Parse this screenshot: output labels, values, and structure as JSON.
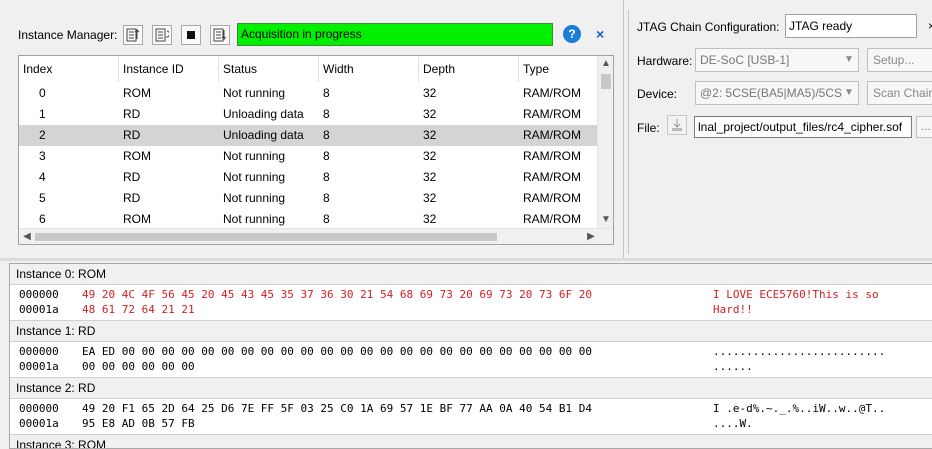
{
  "instance_manager": {
    "label": "Instance Manager:",
    "status_text": "Acquisition in progress",
    "help_label": "?",
    "close_label": "×",
    "columns": [
      "Index",
      "Instance ID",
      "Status",
      "Width",
      "Depth",
      "Type"
    ],
    "rows": [
      {
        "index": "0",
        "id": "ROM",
        "status": "Not running",
        "width": "8",
        "depth": "32",
        "type": "RAM/ROM"
      },
      {
        "index": "1",
        "id": "RD",
        "status": "Unloading data",
        "width": "8",
        "depth": "32",
        "type": "RAM/ROM"
      },
      {
        "index": "2",
        "id": "RD",
        "status": "Unloading data",
        "width": "8",
        "depth": "32",
        "type": "RAM/ROM"
      },
      {
        "index": "3",
        "id": "ROM",
        "status": "Not running",
        "width": "8",
        "depth": "32",
        "type": "RAM/ROM"
      },
      {
        "index": "4",
        "id": "RD",
        "status": "Not running",
        "width": "8",
        "depth": "32",
        "type": "RAM/ROM"
      },
      {
        "index": "5",
        "id": "RD",
        "status": "Not running",
        "width": "8",
        "depth": "32",
        "type": "RAM/ROM"
      },
      {
        "index": "6",
        "id": "ROM",
        "status": "Not running",
        "width": "8",
        "depth": "32",
        "type": "RAM/ROM"
      }
    ],
    "selected_row": 2
  },
  "jtag": {
    "title": "JTAG Chain Configuration:",
    "status": "JTAG ready",
    "close_label": "×",
    "hardware_label": "Hardware:",
    "hardware_value": "DE-SoC [USB-1]",
    "setup_label": "Setup...",
    "device_label": "Device:",
    "device_value": "@2: 5CSE(BA5|MA5)/5CS",
    "scan_label": "Scan Chain",
    "file_label": "File:",
    "file_value": "lnal_project/output_files/rc4_cipher.sof",
    "browse_label": "..."
  },
  "hex_view": {
    "instances": [
      {
        "header": "Instance 0: ROM",
        "highlight": true,
        "lines": [
          {
            "addr": "000000",
            "bytes": "49 20 4C 4F 56 45 20 45 43 45 35 37 36 30 21 54 68 69 73 20 69 73 20 73 6F 20",
            "ascii": "I LOVE ECE5760!This is so"
          },
          {
            "addr": "00001a",
            "bytes": "48 61 72 64 21 21",
            "ascii": "Hard!!"
          }
        ]
      },
      {
        "header": "Instance 1: RD",
        "highlight": false,
        "lines": [
          {
            "addr": "000000",
            "bytes": "EA ED 00 00 00 00 00 00 00 00 00 00 00 00 00 00 00 00 00 00 00 00 00 00 00 00",
            "ascii": ".........................."
          },
          {
            "addr": "00001a",
            "bytes": "00 00 00 00 00 00",
            "ascii": "......"
          }
        ]
      },
      {
        "header": "Instance 2: RD",
        "highlight": false,
        "lines": [
          {
            "addr": "000000",
            "bytes": "49 20 F1 65 2D 64 25 D6 7E FF 5F 03 25 C0 1A 69 57 1E BF 77 AA 0A 40 54 B1 D4",
            "ascii": "I .e-d%.~._.%..iW..w..@T.."
          },
          {
            "addr": "00001a",
            "bytes": "95 E8 AD 0B 57 FB",
            "ascii": "....W."
          }
        ]
      },
      {
        "header": "Instance 3: ROM",
        "highlight": false,
        "lines": []
      }
    ]
  },
  "colors": {
    "status_green": "#00f000",
    "hex_red": "#d42020",
    "selection": "#d4d4d4"
  }
}
